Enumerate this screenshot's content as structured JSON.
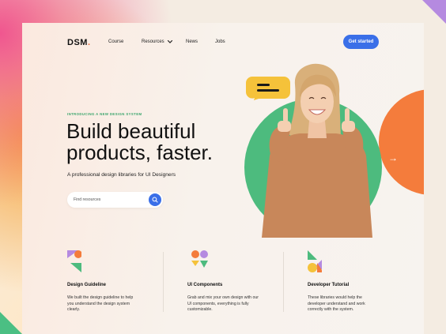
{
  "brand": {
    "logo": "DSM",
    "logo_dot": ".",
    "accent": "#3a6fe8"
  },
  "nav": {
    "items": [
      {
        "label": "Course"
      },
      {
        "label": "Resources"
      },
      {
        "label": "News"
      },
      {
        "label": "Jobs"
      }
    ],
    "cta": "Get started"
  },
  "hero": {
    "eyebrow": "INTRODUCING A NEW DESIGN SYSTEM",
    "headline_line1": "Build beautiful",
    "headline_line2": "products, faster.",
    "subhead": "A professional design libraries for UI Designers",
    "search_placeholder": "Find resources",
    "colors": {
      "green": "#4dbb7e",
      "orange": "#f47c3c",
      "yellow": "#f5c23a"
    }
  },
  "features": [
    {
      "title": "Design Guideline",
      "desc": "We built the design guideline to help you understand the design system clearly.",
      "icon": "design-guideline-icon"
    },
    {
      "title": "UI Components",
      "desc": "Grab and mix your own design with our UI components, everything is fully customizable.",
      "icon": "ui-components-icon"
    },
    {
      "title": "Developer Tutorial",
      "desc": "These libraries would help the developer understand and work correctly with the system.",
      "icon": "developer-tutorial-icon"
    }
  ]
}
